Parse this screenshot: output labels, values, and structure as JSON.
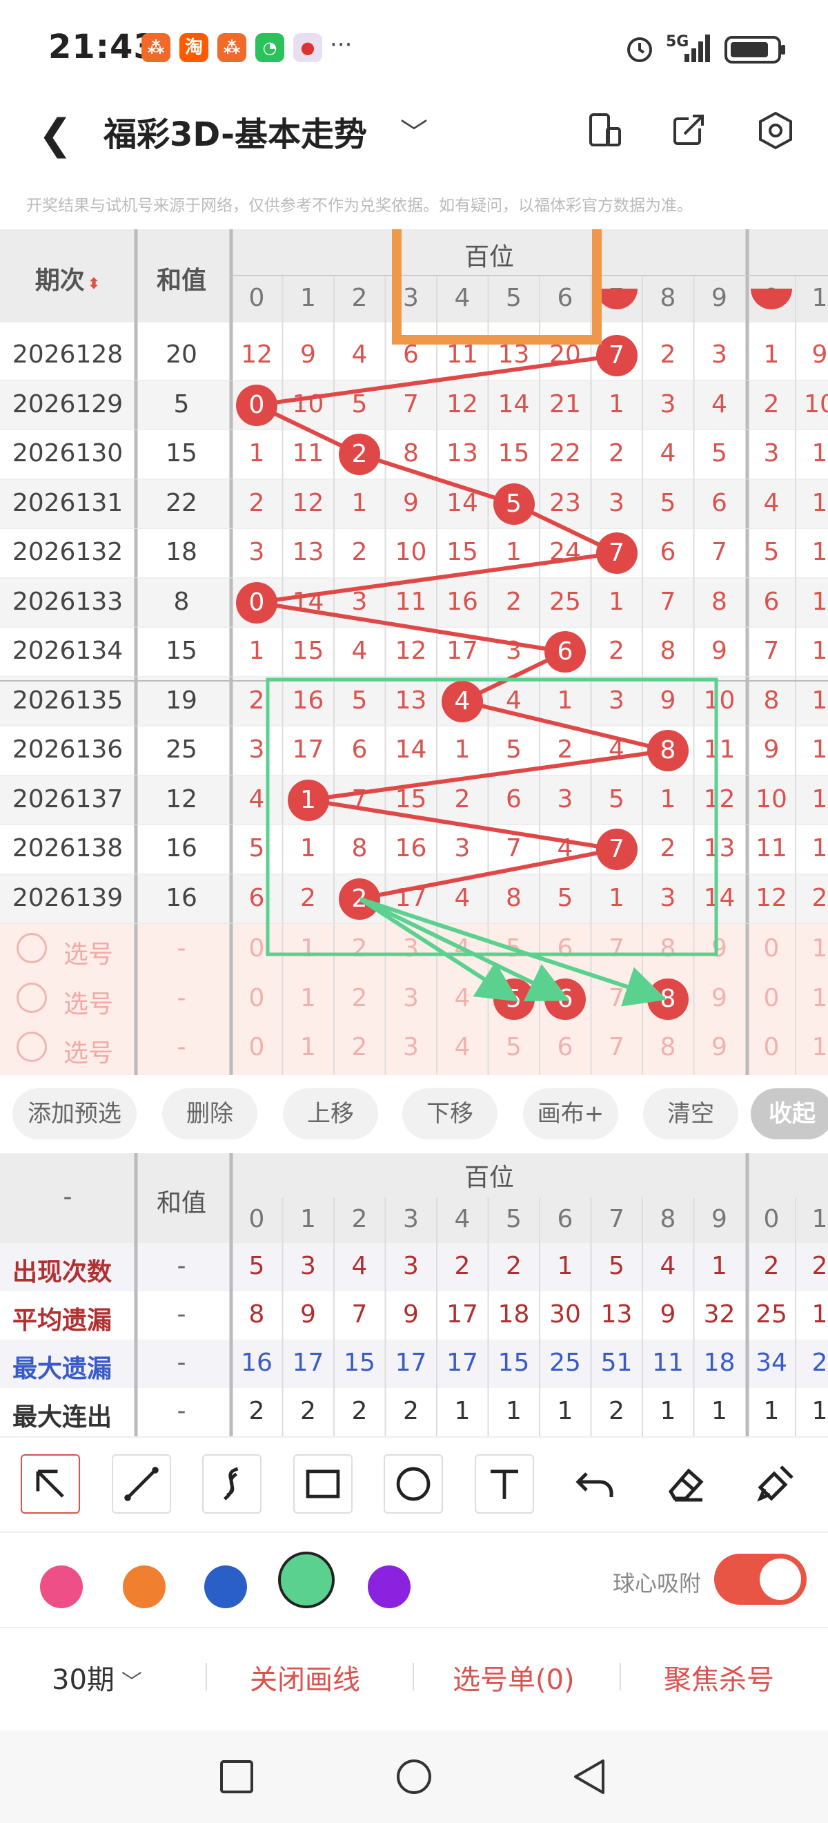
{
  "status_bar": {
    "time": "21:43",
    "app_icons": [
      "app-icon",
      "taobao-icon",
      "app-icon",
      "wechat-icon",
      "app-icon"
    ],
    "more": "···",
    "network": "5G"
  },
  "header": {
    "title": "福彩3D-基本走势",
    "notice": "开奖结果与试机号来源于网络，仅供参考不作为兑奖依据。如有疑问，以福体彩官方数据为准。"
  },
  "table": {
    "col_period": "期次",
    "col_sum": "和值",
    "group_label": "百位",
    "digits": [
      "0",
      "1",
      "2",
      "3",
      "4",
      "5",
      "6",
      "7",
      "8",
      "9"
    ],
    "next_digits": [
      "0",
      "1"
    ],
    "rows": [
      {
        "period": "2026128",
        "sum": "20",
        "cells": [
          "12",
          "9",
          "4",
          "6",
          "11",
          "13",
          "20",
          "7",
          "2",
          "3"
        ],
        "hit": 7,
        "extra": [
          "1",
          "9"
        ]
      },
      {
        "period": "2026129",
        "sum": "5",
        "cells": [
          "0",
          "10",
          "5",
          "7",
          "12",
          "14",
          "21",
          "1",
          "3",
          "4"
        ],
        "hit": 0,
        "extra": [
          "2",
          "10"
        ]
      },
      {
        "period": "2026130",
        "sum": "15",
        "cells": [
          "1",
          "11",
          "2",
          "8",
          "13",
          "15",
          "22",
          "2",
          "4",
          "5"
        ],
        "hit": 2,
        "extra": [
          "3",
          "1"
        ]
      },
      {
        "period": "2026131",
        "sum": "22",
        "cells": [
          "2",
          "12",
          "1",
          "9",
          "14",
          "5",
          "23",
          "3",
          "5",
          "6"
        ],
        "hit": 5,
        "extra": [
          "4",
          "1"
        ]
      },
      {
        "period": "2026132",
        "sum": "18",
        "cells": [
          "3",
          "13",
          "2",
          "10",
          "15",
          "1",
          "24",
          "7",
          "6",
          "7"
        ],
        "hit": 7,
        "extra": [
          "5",
          "1"
        ]
      },
      {
        "period": "2026133",
        "sum": "8",
        "cells": [
          "0",
          "14",
          "3",
          "11",
          "16",
          "2",
          "25",
          "1",
          "7",
          "8"
        ],
        "hit": 0,
        "extra": [
          "6",
          "1"
        ]
      },
      {
        "period": "2026134",
        "sum": "15",
        "cells": [
          "1",
          "15",
          "4",
          "12",
          "17",
          "3",
          "6",
          "2",
          "8",
          "9"
        ],
        "hit": 6,
        "extra": [
          "7",
          "1"
        ]
      },
      {
        "period": "2026135",
        "sum": "19",
        "cells": [
          "2",
          "16",
          "5",
          "13",
          "4",
          "4",
          "1",
          "3",
          "9",
          "10"
        ],
        "hit": 4,
        "extra": [
          "8",
          "1"
        ]
      },
      {
        "period": "2026136",
        "sum": "25",
        "cells": [
          "3",
          "17",
          "6",
          "14",
          "1",
          "5",
          "2",
          "4",
          "8",
          "11"
        ],
        "hit": 8,
        "extra": [
          "9",
          "1"
        ]
      },
      {
        "period": "2026137",
        "sum": "12",
        "cells": [
          "4",
          "1",
          "7",
          "15",
          "2",
          "6",
          "3",
          "5",
          "1",
          "12"
        ],
        "hit": 1,
        "extra": [
          "10",
          "1"
        ]
      },
      {
        "period": "2026138",
        "sum": "16",
        "cells": [
          "5",
          "1",
          "8",
          "16",
          "3",
          "7",
          "4",
          "7",
          "2",
          "13"
        ],
        "hit": 7,
        "extra": [
          "11",
          "1"
        ]
      },
      {
        "period": "2026139",
        "sum": "16",
        "cells": [
          "6",
          "2",
          "2",
          "17",
          "4",
          "8",
          "5",
          "1",
          "3",
          "14"
        ],
        "hit": 2,
        "extra": [
          "12",
          "2"
        ]
      }
    ],
    "select_label": "选号",
    "dash": "-",
    "select_picks": [
      [],
      [
        5,
        6,
        8
      ],
      []
    ]
  },
  "actions": [
    "添加预选",
    "删除",
    "上移",
    "下移",
    "画布+",
    "清空",
    "收起"
  ],
  "stats": {
    "label_dash": "-",
    "sum_label": "和值",
    "group_label": "百位",
    "rows": [
      {
        "label": "出现次数",
        "color": "#b03030",
        "values": [
          "5",
          "3",
          "4",
          "3",
          "2",
          "2",
          "1",
          "5",
          "4",
          "1"
        ],
        "extra": [
          "2",
          "2"
        ]
      },
      {
        "label": "平均遗漏",
        "color": "#b03030",
        "values": [
          "8",
          "9",
          "7",
          "9",
          "17",
          "18",
          "30",
          "13",
          "9",
          "32"
        ],
        "extra": [
          "25",
          "1"
        ]
      },
      {
        "label": "最大遗漏",
        "color": "#3a5bc7",
        "values": [
          "16",
          "17",
          "15",
          "17",
          "17",
          "15",
          "25",
          "51",
          "11",
          "18"
        ],
        "extra": [
          "34",
          "2"
        ]
      },
      {
        "label": "最大连出",
        "color": "#333333",
        "values": [
          "2",
          "2",
          "2",
          "2",
          "1",
          "1",
          "1",
          "2",
          "1",
          "1"
        ],
        "extra": [
          "1",
          "1"
        ]
      }
    ]
  },
  "tools": [
    "select-arrow-icon",
    "line-icon",
    "curve-icon",
    "rectangle-icon",
    "circle-icon",
    "text-icon",
    "undo-icon",
    "eraser-icon",
    "brush-clear-icon"
  ],
  "colors": [
    "#ee4f86",
    "#f08030",
    "#2a5fc8",
    "#5bd18f",
    "#8a22e0"
  ],
  "snap_label": "球心吸附",
  "bottom_nav": {
    "periods": "30期",
    "close_line": "关闭画线",
    "pick_list": "选号单(0)",
    "focus_kill": "聚焦杀号"
  }
}
